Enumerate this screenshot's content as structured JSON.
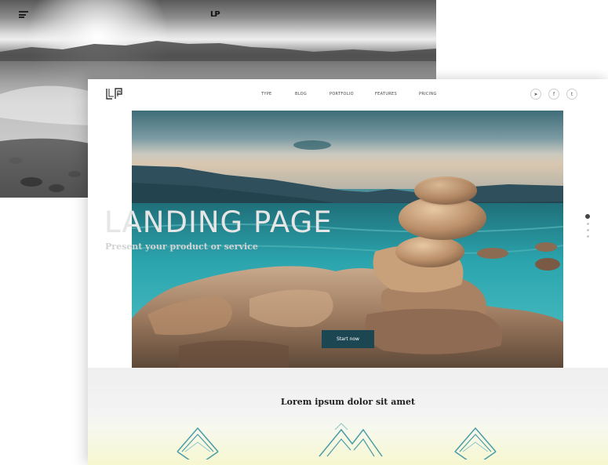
{
  "back_page": {
    "logo_text": "LP",
    "menu_icon": "hamburger-menu-icon"
  },
  "front_page": {
    "logo": "lp-logo",
    "nav": {
      "items": [
        {
          "label": "TYPE"
        },
        {
          "label": "BLOG"
        },
        {
          "label": "PORTFOLIO"
        },
        {
          "label": "FEATURES"
        },
        {
          "label": "PRICING"
        }
      ]
    },
    "social": [
      {
        "icon": "send-icon",
        "glyph": "➤"
      },
      {
        "icon": "facebook-icon",
        "glyph": "f"
      },
      {
        "icon": "twitter-icon",
        "glyph": "t"
      }
    ],
    "hero": {
      "title": "LANDING PAGE",
      "subtitle": "Present your product or service",
      "cta_label": "Start now"
    },
    "slider": {
      "total": 4,
      "active_index": 1
    },
    "section": {
      "title": "Lorem ipsum dolor sit amet",
      "icons": [
        "double-diamond-icon",
        "double-mountain-icon",
        "double-diamond-icon"
      ]
    },
    "colors": {
      "accent": "#1c4652",
      "feature_icon": "#4a9ca8",
      "section_fade": "#f6f7cf"
    }
  }
}
